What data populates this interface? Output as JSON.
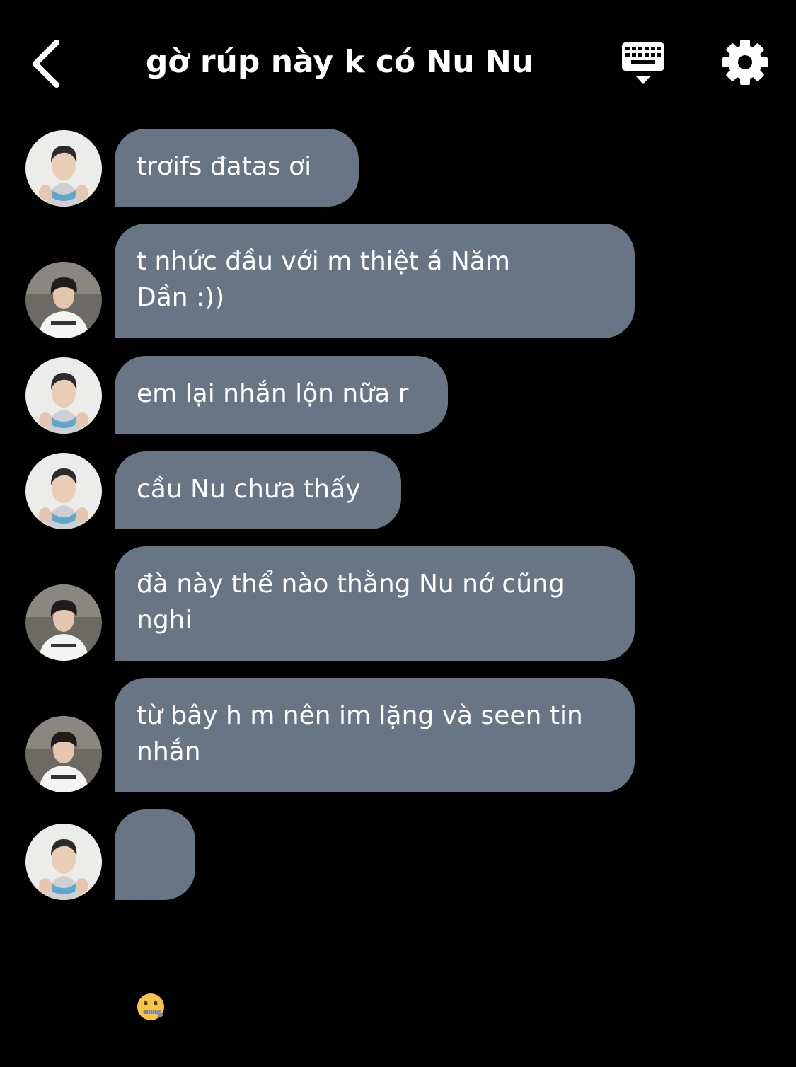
{
  "header": {
    "title": "gờ rúp này k có Nu Nu",
    "back_icon": "chevron-left-icon",
    "keyboard_icon": "keyboard-icon",
    "settings_icon": "gear-icon"
  },
  "colors": {
    "background": "#000000",
    "bubble": "#687584",
    "text": "#ffffff"
  },
  "messages": [
    {
      "sender_avatar": "avatar-a",
      "text": "trơifs đatas ơi"
    },
    {
      "sender_avatar": "avatar-b",
      "text": "t nhức đầu với m thiệt á Năm\nDần :))"
    },
    {
      "sender_avatar": "avatar-a",
      "text": "em lại nhắn lộn nữa r"
    },
    {
      "sender_avatar": "avatar-a",
      "text": "cầu Nu chưa thấy"
    },
    {
      "sender_avatar": "avatar-b",
      "text": "đà này thể nào thằng Nu nớ cũng\nnghi"
    },
    {
      "sender_avatar": "avatar-b",
      "text": "từ bây h m nên im lặng và seen tin\nnhắn"
    },
    {
      "sender_avatar": "avatar-a",
      "emoji": "zipper-mouth-face-emoji"
    }
  ]
}
